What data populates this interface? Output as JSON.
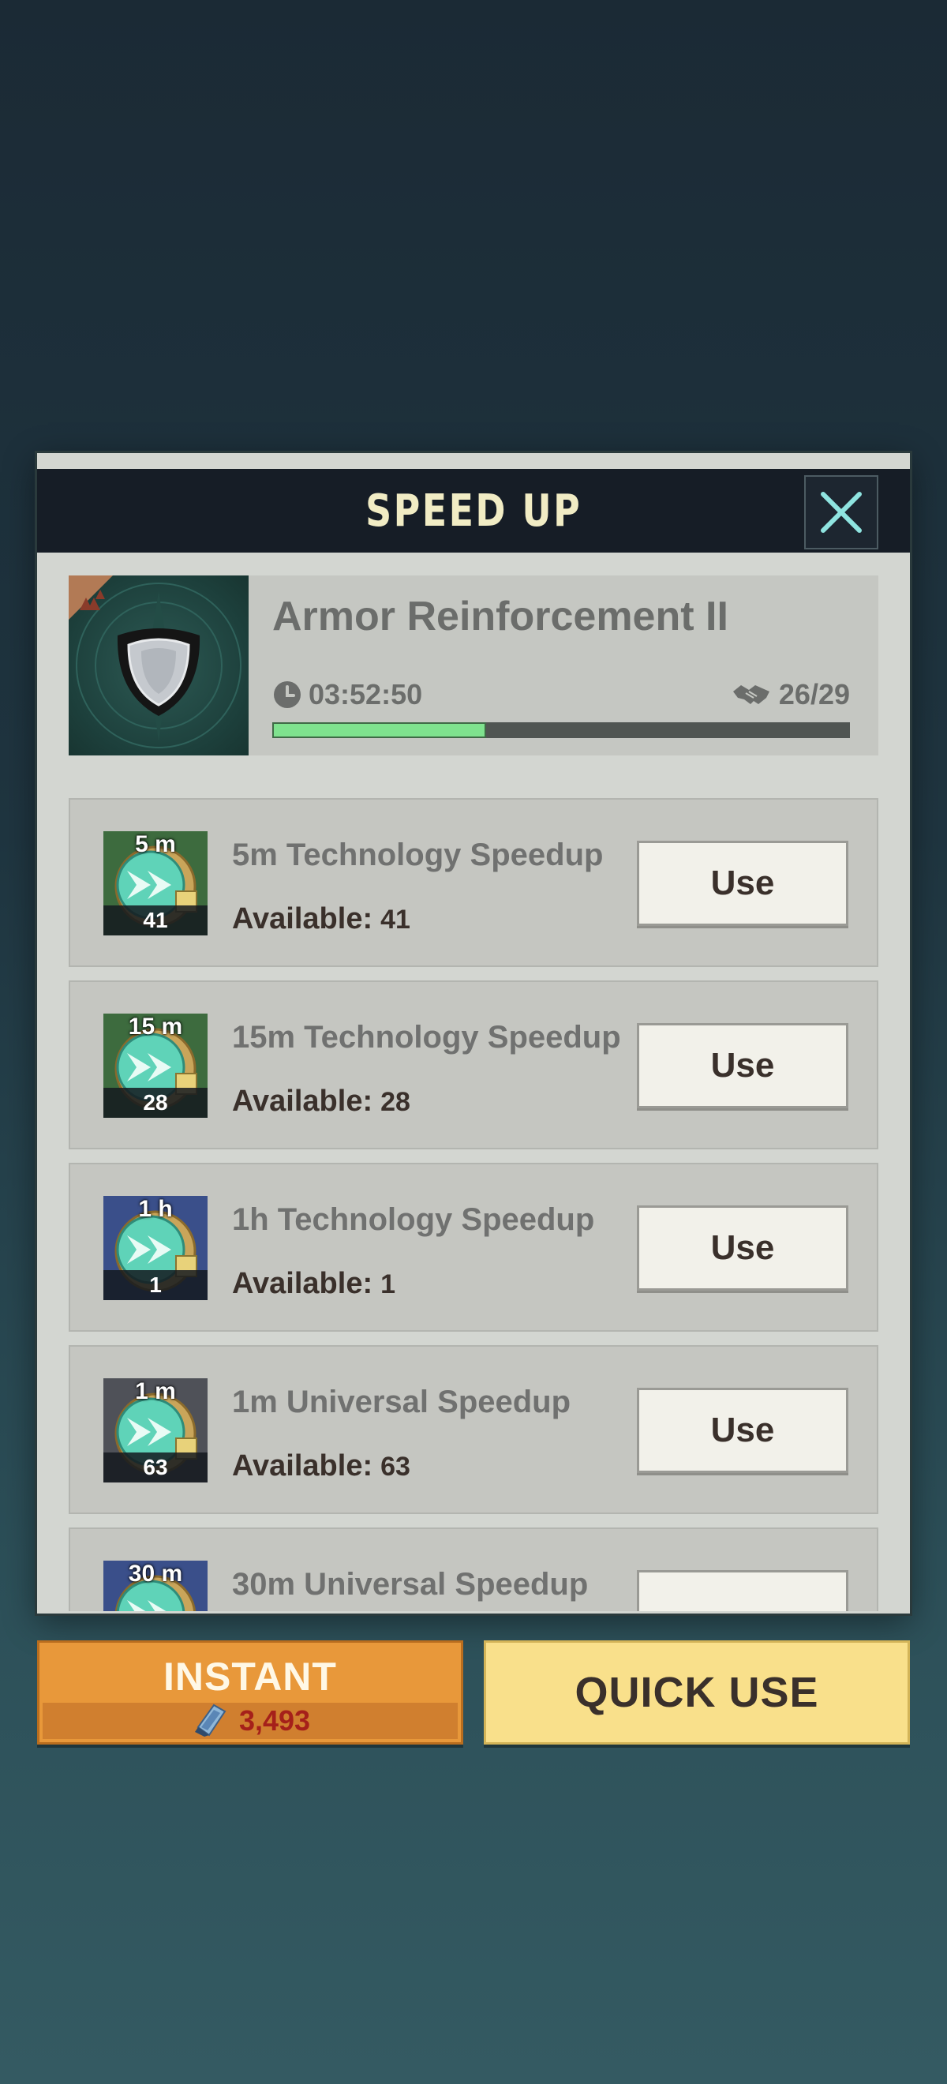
{
  "dialog": {
    "title": "SPEED UP",
    "close_icon": "close-icon"
  },
  "research": {
    "name": "Armor Reinforcement II",
    "timer": "03:52:50",
    "helpers": "26/29",
    "progress_fraction": 0.37,
    "icon": "shield-icon"
  },
  "items": [
    {
      "badge": "5 m",
      "count": "41",
      "name": "5m Technology Speedup",
      "available_label": "Available:",
      "available": "41",
      "use_label": "Use",
      "icon": "technology-speedup-icon",
      "bg": "#3d6b3e"
    },
    {
      "badge": "15 m",
      "count": "28",
      "name": "15m Technology Speedup",
      "available_label": "Available:",
      "available": "28",
      "use_label": "Use",
      "icon": "technology-speedup-icon",
      "bg": "#3d6b3e"
    },
    {
      "badge": "1 h",
      "count": "1",
      "name": "1h Technology Speedup",
      "available_label": "Available:",
      "available": "1",
      "use_label": "Use",
      "icon": "technology-speedup-icon",
      "bg": "#3a4f8a"
    },
    {
      "badge": "1 m",
      "count": "63",
      "name": "1m Universal Speedup",
      "available_label": "Available:",
      "available": "63",
      "use_label": "Use",
      "icon": "universal-speedup-icon",
      "bg": "#4f5158"
    },
    {
      "badge": "30 m",
      "count": "",
      "name": "30m Universal Speedup",
      "available_label": "",
      "available": "",
      "use_label": "",
      "icon": "universal-speedup-icon",
      "bg": "#3a4f8a"
    }
  ],
  "actions": {
    "instant_label": "INSTANT",
    "instant_cost": "3,493",
    "quick_use_label": "QUICK USE"
  },
  "colors": {
    "progress": "#7fe28e",
    "instant": "#e8983a",
    "quick_use": "#f9e08b",
    "cost": "#a5201a"
  }
}
